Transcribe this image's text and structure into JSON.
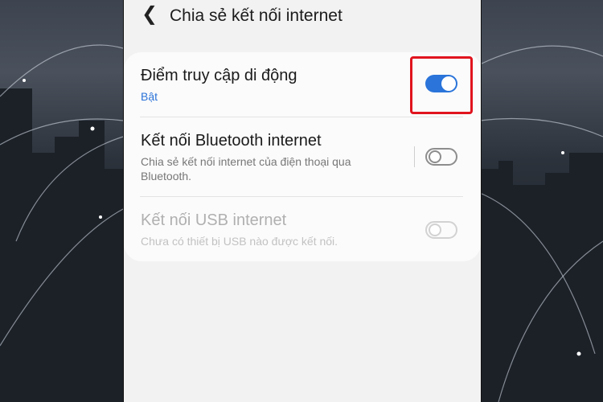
{
  "header": {
    "back_icon": "chevron-left-icon",
    "title": "Chia sẻ kết nối internet"
  },
  "settings": [
    {
      "label": "Điểm truy cập di động",
      "status": "Bật",
      "toggle": "on"
    },
    {
      "label": "Kết nối Bluetooth internet",
      "description": "Chia sẻ kết nối internet của điện thoại qua Bluetooth.",
      "toggle": "off"
    },
    {
      "label": "Kết nối USB internet",
      "description": "Chưa có thiết bị USB nào được kết nối.",
      "toggle": "disabled"
    }
  ],
  "colors": {
    "accent": "#2a74da",
    "highlight": "#e0141e"
  }
}
